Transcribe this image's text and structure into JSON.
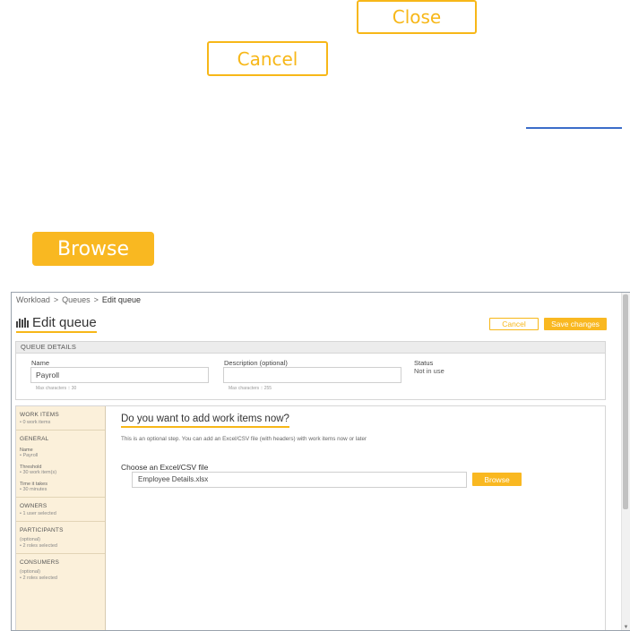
{
  "callouts": {
    "close_label": "Close",
    "cancel_label": "Cancel",
    "browse_label": "Browse"
  },
  "breadcrumb": {
    "items": [
      "Workload",
      "Queues",
      "Edit queue"
    ],
    "separator": ">"
  },
  "header": {
    "title": "Edit queue",
    "title_icon": "queue-bars-icon",
    "cancel_label": "Cancel",
    "save_label": "Save changes"
  },
  "queue_details": {
    "heading": "QUEUE DETAILS",
    "name_label": "Name",
    "name_value": "Payroll",
    "name_hint": "Max characters :: 30",
    "description_label": "Description (optional)",
    "description_value": "",
    "description_hint": "Max characters :: 255",
    "status_label": "Status",
    "status_value": "Not in use"
  },
  "sidebar": {
    "work_items": {
      "heading": "WORK ITEMS",
      "sub": "• 0 work items"
    },
    "general": {
      "heading": "GENERAL",
      "name_label": "Name",
      "name_value": "• Payroll",
      "threshold_label": "Threshold",
      "threshold_value": "• 30 work item(s)",
      "time_label": "Time it takes",
      "time_value": "• 30 minutes"
    },
    "owners": {
      "heading": "OWNERS",
      "sub": "• 1 user selected"
    },
    "participants": {
      "heading": "PARTICIPANTS",
      "optional": "(optional)",
      "sub": "• 2 roles selected"
    },
    "consumers": {
      "heading": "CONSUMERS",
      "optional": "(optional)",
      "sub": "• 2 roles selected"
    }
  },
  "main": {
    "title": "Do you want to add work items now?",
    "description": "This is an optional step. You can add an Excel/CSV file (with headers) with work items now or later",
    "file_label": "Choose an Excel/CSV file",
    "file_value": "Employee Details.xlsx",
    "browse_label": "Browse"
  },
  "colors": {
    "accent": "#f9b821",
    "accent_outline": "#f7b718",
    "sidebar_bg": "#fbf0da",
    "link_underline": "#3b6dc9"
  }
}
